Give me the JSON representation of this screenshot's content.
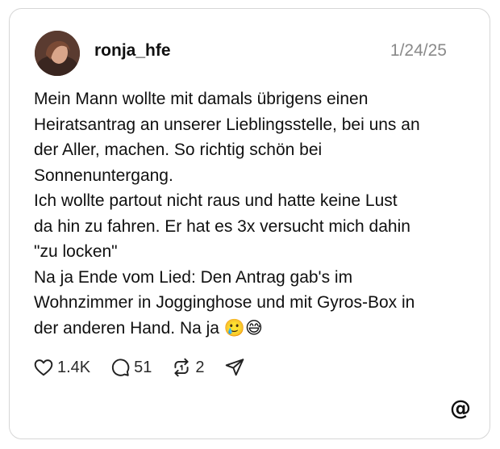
{
  "post": {
    "username": "ronja_hfe",
    "date": "1/24/25",
    "lines": [
      "Mein Mann wollte mit damals übrigens einen",
      "Heiratsantrag an unserer Lieblingsstelle, bei uns an",
      "der Aller, machen. So richtig schön bei",
      "Sonnenuntergang.",
      "Ich wollte partout nicht raus und hatte keine Lust",
      "da hin zu fahren. Er hat es 3x versucht mich dahin",
      "\"zu locken\"",
      "Na ja Ende vom Lied: Den Antrag gab's im",
      "Wohnzimmer in Jogginghose und mit Gyros-Box in",
      "der anderen Hand. Na ja 🥲😅"
    ]
  },
  "actions": {
    "likes": "1.4K",
    "replies": "51",
    "reposts": "2"
  },
  "icons": {
    "like": "heart-icon",
    "reply": "comment-icon",
    "repost": "repost-icon",
    "share": "send-icon",
    "brand": "threads-logo-icon"
  },
  "brand": {
    "logo_glyph": "@"
  }
}
